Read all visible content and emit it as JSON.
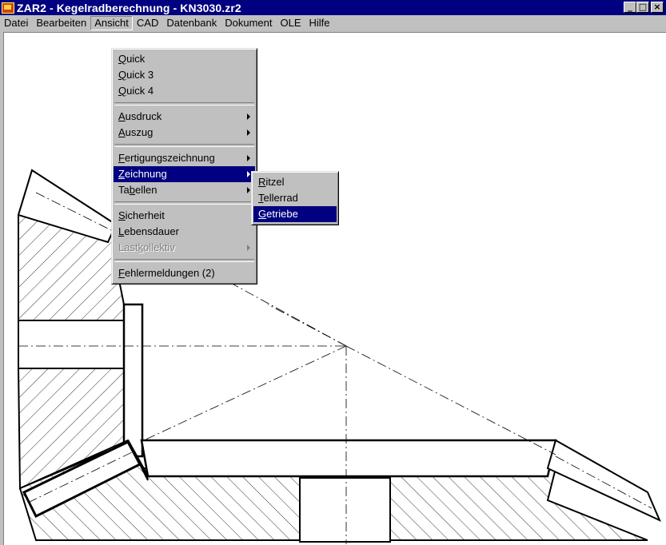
{
  "window": {
    "title": "ZAR2 - Kegelradberechnung  -  KN3030.zr2",
    "buttons": {
      "minimize": "_",
      "maximize": "□",
      "close": "×"
    }
  },
  "menubar": {
    "items": [
      "Datei",
      "Bearbeiten",
      "Ansicht",
      "CAD",
      "Datenbank",
      "Dokument",
      "OLE",
      "Hilfe"
    ],
    "active": "Ansicht"
  },
  "ansicht_menu": {
    "group1": [
      {
        "label": "Quick",
        "ul": "Q",
        "rest": "uick"
      },
      {
        "label": "Quick 3",
        "ul": "Q",
        "rest": "uick 3"
      },
      {
        "label": "Quick 4",
        "ul": "Q",
        "rest": "uick 4"
      }
    ],
    "group2": [
      {
        "label": "Ausdruck",
        "ul": "A",
        "rest": "usdruck",
        "submenu": true
      },
      {
        "label": "Auszug",
        "ul": "A",
        "rest": "uszug",
        "submenu": true
      }
    ],
    "group3": [
      {
        "label": "Fertigungszeichnung",
        "ul": "F",
        "rest": "ertigungszeichnung",
        "submenu": true
      },
      {
        "label": "Zeichnung",
        "ul": "Z",
        "rest": "eichnung",
        "submenu": true,
        "highlighted": true
      },
      {
        "label": "Tabellen",
        "pre": "Ta",
        "ul": "b",
        "rest": "ellen",
        "submenu": true
      }
    ],
    "group4": [
      {
        "label": "Sicherheit",
        "ul": "S",
        "rest": "icherheit"
      },
      {
        "label": "Lebensdauer",
        "ul": "L",
        "rest": "ebensdauer"
      },
      {
        "label": "Lastkollektiv",
        "pre": "Last",
        "ul": "k",
        "rest": "ollektiv",
        "submenu": true,
        "disabled": true
      }
    ],
    "group5": [
      {
        "label": "Fehlermeldungen (2)",
        "ul": "F",
        "rest": "ehlermeldungen (2)"
      }
    ]
  },
  "zeichnung_submenu": [
    {
      "label": "Ritzel",
      "ul": "R",
      "rest": "itzel"
    },
    {
      "label": "Tellerrad",
      "ul": "T",
      "rest": "ellerrad"
    },
    {
      "label": "Getriebe",
      "ul": "G",
      "rest": "etriebe",
      "highlighted": true
    }
  ]
}
